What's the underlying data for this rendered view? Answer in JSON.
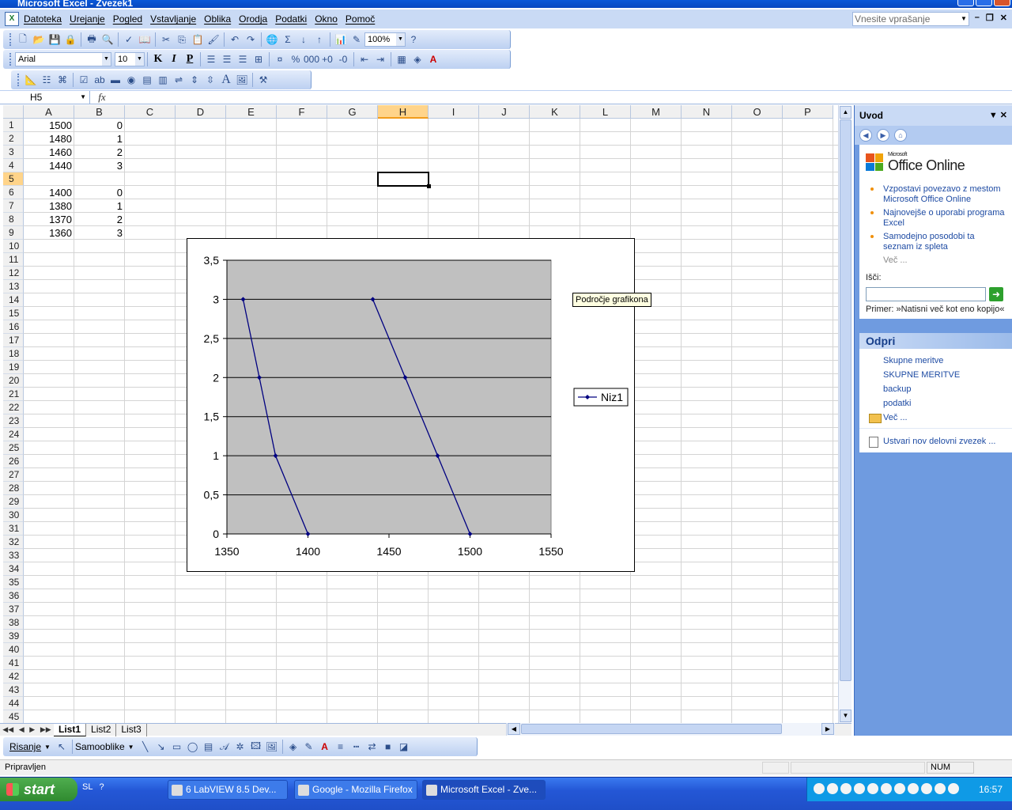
{
  "window": {
    "title": "Microsoft Excel - Zvezek1",
    "ask_placeholder": "Vnesite vprašanje"
  },
  "menu": [
    "Datoteka",
    "Urejanje",
    "Pogled",
    "Vstavljanje",
    "Oblika",
    "Orodja",
    "Podatki",
    "Okno",
    "Pomoč"
  ],
  "toolbar": {
    "zoom": "100%",
    "font": "Arial",
    "font_size": "10",
    "bold": "K",
    "italic": "I",
    "underline": "P"
  },
  "formula_bar": {
    "name_box": "H5",
    "fx": "fx",
    "formula": ""
  },
  "columns": [
    "A",
    "B",
    "C",
    "D",
    "E",
    "F",
    "G",
    "H",
    "I",
    "J",
    "K",
    "L",
    "M",
    "N",
    "O",
    "P"
  ],
  "active_column": "H",
  "active_row": 5,
  "row_count": 45,
  "cells": [
    {
      "row": 1,
      "col": "A",
      "v": "1500"
    },
    {
      "row": 1,
      "col": "B",
      "v": "0"
    },
    {
      "row": 2,
      "col": "A",
      "v": "1480"
    },
    {
      "row": 2,
      "col": "B",
      "v": "1"
    },
    {
      "row": 3,
      "col": "A",
      "v": "1460"
    },
    {
      "row": 3,
      "col": "B",
      "v": "2"
    },
    {
      "row": 4,
      "col": "A",
      "v": "1440"
    },
    {
      "row": 4,
      "col": "B",
      "v": "3"
    },
    {
      "row": 6,
      "col": "A",
      "v": "1400"
    },
    {
      "row": 6,
      "col": "B",
      "v": "0"
    },
    {
      "row": 7,
      "col": "A",
      "v": "1380"
    },
    {
      "row": 7,
      "col": "B",
      "v": "1"
    },
    {
      "row": 8,
      "col": "A",
      "v": "1370"
    },
    {
      "row": 8,
      "col": "B",
      "v": "2"
    },
    {
      "row": 9,
      "col": "A",
      "v": "1360"
    },
    {
      "row": 9,
      "col": "B",
      "v": "3"
    }
  ],
  "sheets": [
    "List1",
    "List2",
    "List3"
  ],
  "active_sheet": "List1",
  "tooltip": "Področje grafikona",
  "chart_data": {
    "type": "scatter",
    "series": [
      {
        "name": "Niz1",
        "points": [
          [
            1500,
            0
          ],
          [
            1480,
            1
          ],
          [
            1460,
            2
          ],
          [
            1440,
            3
          ],
          [
            null,
            null
          ],
          [
            1400,
            0
          ],
          [
            1380,
            1
          ],
          [
            1370,
            2
          ],
          [
            1360,
            3
          ]
        ]
      }
    ],
    "xlim": [
      1350,
      1550
    ],
    "ylim": [
      0,
      3.5
    ],
    "x_ticks": [
      "1350",
      "1400",
      "1450",
      "1500",
      "1550"
    ],
    "y_ticks": [
      "0",
      "0,5",
      "1",
      "1,5",
      "2",
      "2,5",
      "3",
      "3,5"
    ],
    "grid": true,
    "legend": "right",
    "plot_bg": "#c0c0c0",
    "line_color": "#000080"
  },
  "task_pane": {
    "title": "Uvod",
    "logo_small": "Microsoft",
    "logo": "Office Online",
    "links": [
      "Vzpostavi povezavo z mestom Microsoft Office Online",
      "Najnovejše o uporabi programa Excel",
      "Samodejno posodobi ta seznam iz spleta"
    ],
    "more": "Več ...",
    "search_label": "Išči:",
    "search_example": "Primer:  »Natisni več kot eno kopijo«",
    "open_title": "Odpri",
    "open_items": [
      "Skupne meritve",
      "SKUPNE MERITVE",
      "backup",
      "podatki"
    ],
    "open_more": "Več ...",
    "new_workbook": "Ustvari nov delovni zvezek ..."
  },
  "drawing": {
    "draw": "Risanje",
    "shapes": "Samooblike"
  },
  "status": {
    "text": "Pripravljen",
    "num": "NUM"
  },
  "taskbar": {
    "start": "start",
    "lang": "SL",
    "tasks": [
      "6 LabVIEW 8.5 Dev...",
      "Google - Mozilla Firefox",
      "Microsoft Excel - Zve..."
    ],
    "clock": "16:57"
  }
}
